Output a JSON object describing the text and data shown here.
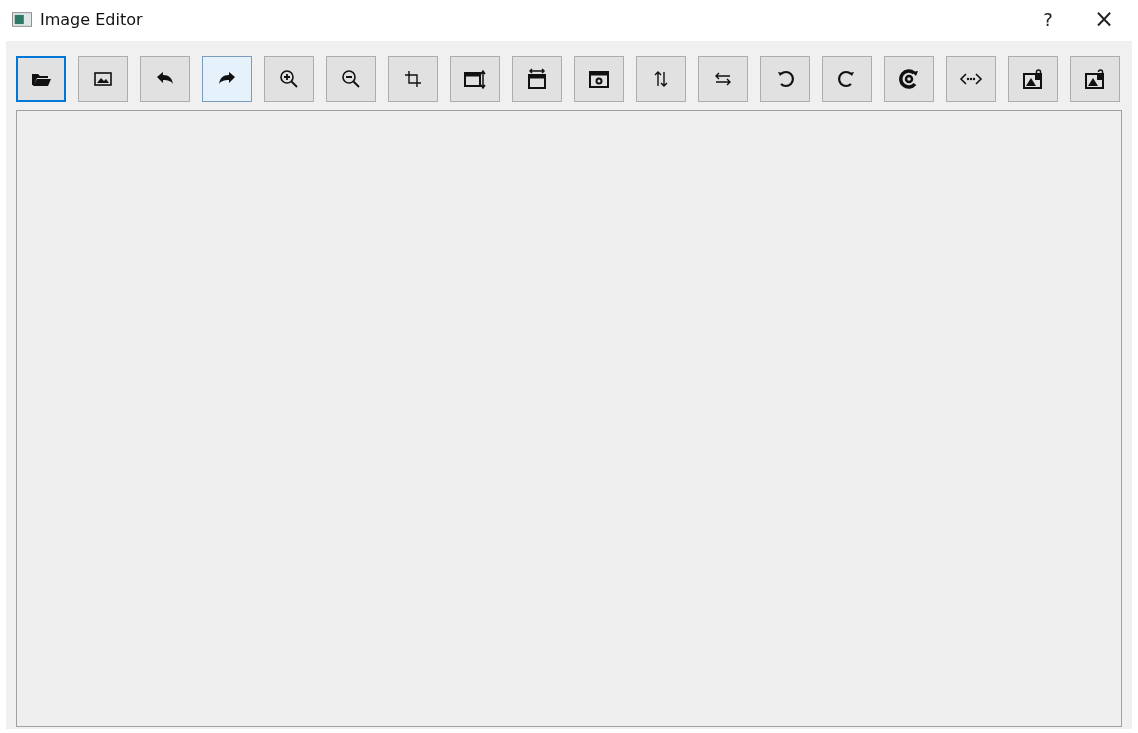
{
  "window": {
    "title": "Image Editor",
    "help": "?",
    "close": "×"
  },
  "toolbar": [
    {
      "focused": true,
      "hovered": false
    },
    {
      "focused": false,
      "hovered": false
    },
    {
      "focused": false,
      "hovered": false
    },
    {
      "focused": false,
      "hovered": true
    },
    {
      "focused": false,
      "hovered": false
    },
    {
      "focused": false,
      "hovered": false
    },
    {
      "focused": false,
      "hovered": false
    },
    {
      "focused": false,
      "hovered": false
    },
    {
      "focused": false,
      "hovered": false
    },
    {
      "focused": false,
      "hovered": false
    },
    {
      "focused": false,
      "hovered": false
    },
    {
      "focused": false,
      "hovered": false
    },
    {
      "focused": false,
      "hovered": false
    },
    {
      "focused": false,
      "hovered": false
    },
    {
      "focused": false,
      "hovered": false
    },
    {
      "focused": false,
      "hovered": false
    },
    {
      "focused": false,
      "hovered": false
    },
    {
      "focused": false,
      "hovered": false
    }
  ]
}
